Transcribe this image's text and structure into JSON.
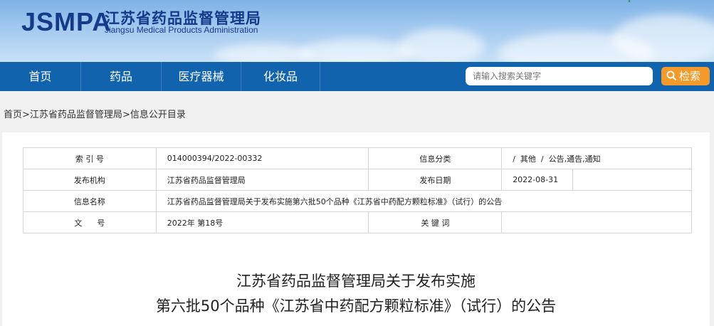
{
  "header": {
    "logo_mark": "JSMPA",
    "title_cn": "江苏省药品监督管理局",
    "title_en": "Jiangsu Medical Products Administration"
  },
  "nav": {
    "items": [
      "首页",
      "药品",
      "医疗器械",
      "化妆品"
    ],
    "search_placeholder": "请输入搜索关键字",
    "search_button": "检索"
  },
  "breadcrumb": {
    "items": [
      "首页",
      "江苏省药品监督管理局",
      "信息公开目录"
    ],
    "separator": ">"
  },
  "meta": {
    "index_label": "索 引 号",
    "index_value": "014000394/2022-00332",
    "category_label": "信息分类",
    "category_value": "/  其他  /  公告,通告,通知",
    "publisher_label": "发布机构",
    "publisher_value": "江苏省药品监督管理局",
    "date_label": "发布日期",
    "date_value": "2022-08-31",
    "name_label": "信息名称",
    "name_value": "江苏省药品监督管理局关于发布实施第六批50个品种《江苏省中药配方颗粒标准》（试行）的公告",
    "doc_label": "文      号",
    "doc_value": "2022年 第18号",
    "keywords_label": "关 键 词",
    "keywords_value": ""
  },
  "article": {
    "title_line1": "江苏省药品监督管理局关于发布实施",
    "title_line2": "第六批50个品种《江苏省中药配方颗粒标准》（试行）的公告"
  },
  "colors": {
    "nav_bg": "#1163ad",
    "search_button_bg": "#f39a2b",
    "logo": "#143a8a"
  }
}
